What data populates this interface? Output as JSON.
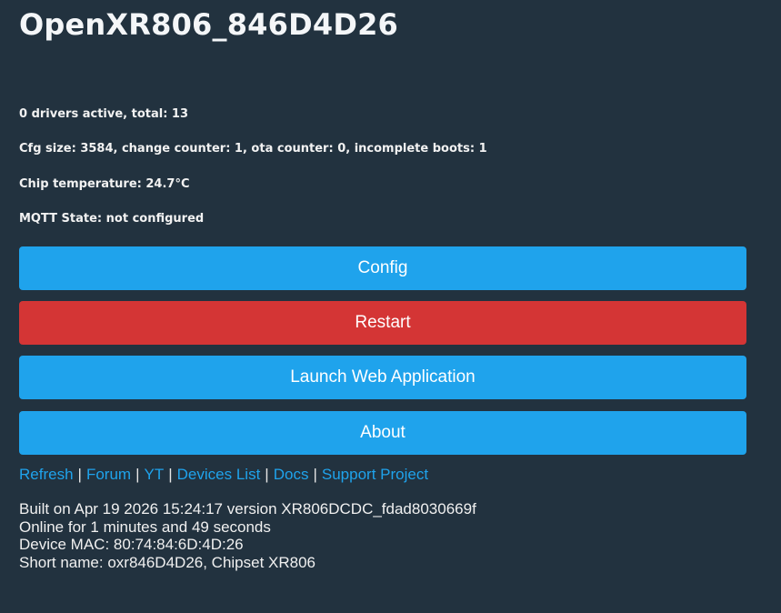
{
  "header": {
    "title": "OpenXR806_846D4D26"
  },
  "status": {
    "drivers": "0 drivers active, total: 13",
    "cfg": "Cfg size: 3584, change counter: 1, ota counter: 0, incomplete boots: 1",
    "temperature": "Chip temperature: 24.7°C",
    "mqtt": "MQTT State: not configured"
  },
  "buttons": {
    "config": "Config",
    "restart": "Restart",
    "launch": "Launch Web Application",
    "about": "About"
  },
  "links": {
    "refresh": "Refresh",
    "forum": "Forum",
    "yt": "YT",
    "devices": "Devices List",
    "docs": "Docs",
    "support": "Support Project",
    "separator": "|"
  },
  "info": {
    "built": "Built on Apr 19 2026 15:24:17 version XR806DCDC_fdad8030669f",
    "online": "Online for 1 minutes and 49 seconds",
    "mac": "Device MAC: 80:74:84:6D:4D:26",
    "short_name": "Short name: oxr846D4D26, Chipset XR806"
  },
  "colors": {
    "background": "#22323f",
    "primary_button": "#1fa3ec",
    "danger_button": "#d43535",
    "link": "#1fa3ec"
  }
}
